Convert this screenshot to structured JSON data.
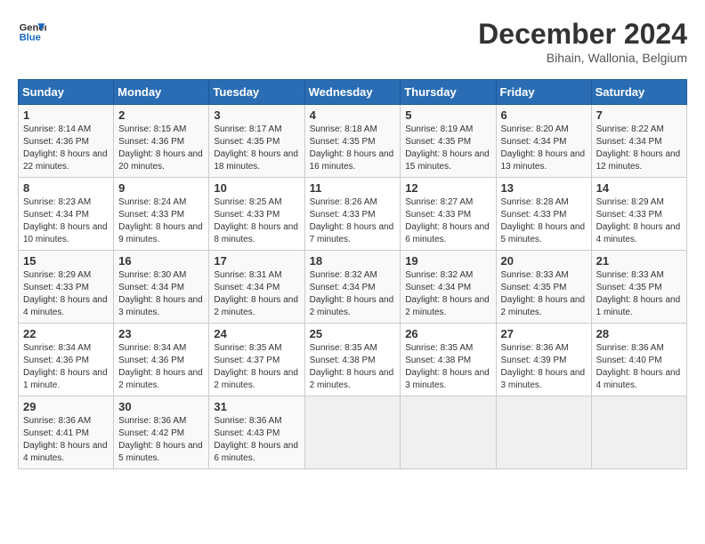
{
  "header": {
    "logo_line1": "General",
    "logo_line2": "Blue",
    "month_year": "December 2024",
    "location": "Bihain, Wallonia, Belgium"
  },
  "weekdays": [
    "Sunday",
    "Monday",
    "Tuesday",
    "Wednesday",
    "Thursday",
    "Friday",
    "Saturday"
  ],
  "weeks": [
    [
      {
        "day": "1",
        "sunrise": "8:14 AM",
        "sunset": "4:36 PM",
        "daylight": "8 hours and 22 minutes."
      },
      {
        "day": "2",
        "sunrise": "8:15 AM",
        "sunset": "4:36 PM",
        "daylight": "8 hours and 20 minutes."
      },
      {
        "day": "3",
        "sunrise": "8:17 AM",
        "sunset": "4:35 PM",
        "daylight": "8 hours and 18 minutes."
      },
      {
        "day": "4",
        "sunrise": "8:18 AM",
        "sunset": "4:35 PM",
        "daylight": "8 hours and 16 minutes."
      },
      {
        "day": "5",
        "sunrise": "8:19 AM",
        "sunset": "4:35 PM",
        "daylight": "8 hours and 15 minutes."
      },
      {
        "day": "6",
        "sunrise": "8:20 AM",
        "sunset": "4:34 PM",
        "daylight": "8 hours and 13 minutes."
      },
      {
        "day": "7",
        "sunrise": "8:22 AM",
        "sunset": "4:34 PM",
        "daylight": "8 hours and 12 minutes."
      }
    ],
    [
      {
        "day": "8",
        "sunrise": "8:23 AM",
        "sunset": "4:34 PM",
        "daylight": "8 hours and 10 minutes."
      },
      {
        "day": "9",
        "sunrise": "8:24 AM",
        "sunset": "4:33 PM",
        "daylight": "8 hours and 9 minutes."
      },
      {
        "day": "10",
        "sunrise": "8:25 AM",
        "sunset": "4:33 PM",
        "daylight": "8 hours and 8 minutes."
      },
      {
        "day": "11",
        "sunrise": "8:26 AM",
        "sunset": "4:33 PM",
        "daylight": "8 hours and 7 minutes."
      },
      {
        "day": "12",
        "sunrise": "8:27 AM",
        "sunset": "4:33 PM",
        "daylight": "8 hours and 6 minutes."
      },
      {
        "day": "13",
        "sunrise": "8:28 AM",
        "sunset": "4:33 PM",
        "daylight": "8 hours and 5 minutes."
      },
      {
        "day": "14",
        "sunrise": "8:29 AM",
        "sunset": "4:33 PM",
        "daylight": "8 hours and 4 minutes."
      }
    ],
    [
      {
        "day": "15",
        "sunrise": "8:29 AM",
        "sunset": "4:33 PM",
        "daylight": "8 hours and 4 minutes."
      },
      {
        "day": "16",
        "sunrise": "8:30 AM",
        "sunset": "4:34 PM",
        "daylight": "8 hours and 3 minutes."
      },
      {
        "day": "17",
        "sunrise": "8:31 AM",
        "sunset": "4:34 PM",
        "daylight": "8 hours and 2 minutes."
      },
      {
        "day": "18",
        "sunrise": "8:32 AM",
        "sunset": "4:34 PM",
        "daylight": "8 hours and 2 minutes."
      },
      {
        "day": "19",
        "sunrise": "8:32 AM",
        "sunset": "4:34 PM",
        "daylight": "8 hours and 2 minutes."
      },
      {
        "day": "20",
        "sunrise": "8:33 AM",
        "sunset": "4:35 PM",
        "daylight": "8 hours and 2 minutes."
      },
      {
        "day": "21",
        "sunrise": "8:33 AM",
        "sunset": "4:35 PM",
        "daylight": "8 hours and 1 minute."
      }
    ],
    [
      {
        "day": "22",
        "sunrise": "8:34 AM",
        "sunset": "4:36 PM",
        "daylight": "8 hours and 1 minute."
      },
      {
        "day": "23",
        "sunrise": "8:34 AM",
        "sunset": "4:36 PM",
        "daylight": "8 hours and 2 minutes."
      },
      {
        "day": "24",
        "sunrise": "8:35 AM",
        "sunset": "4:37 PM",
        "daylight": "8 hours and 2 minutes."
      },
      {
        "day": "25",
        "sunrise": "8:35 AM",
        "sunset": "4:38 PM",
        "daylight": "8 hours and 2 minutes."
      },
      {
        "day": "26",
        "sunrise": "8:35 AM",
        "sunset": "4:38 PM",
        "daylight": "8 hours and 3 minutes."
      },
      {
        "day": "27",
        "sunrise": "8:36 AM",
        "sunset": "4:39 PM",
        "daylight": "8 hours and 3 minutes."
      },
      {
        "day": "28",
        "sunrise": "8:36 AM",
        "sunset": "4:40 PM",
        "daylight": "8 hours and 4 minutes."
      }
    ],
    [
      {
        "day": "29",
        "sunrise": "8:36 AM",
        "sunset": "4:41 PM",
        "daylight": "8 hours and 4 minutes."
      },
      {
        "day": "30",
        "sunrise": "8:36 AM",
        "sunset": "4:42 PM",
        "daylight": "8 hours and 5 minutes."
      },
      {
        "day": "31",
        "sunrise": "8:36 AM",
        "sunset": "4:43 PM",
        "daylight": "8 hours and 6 minutes."
      },
      null,
      null,
      null,
      null
    ]
  ]
}
